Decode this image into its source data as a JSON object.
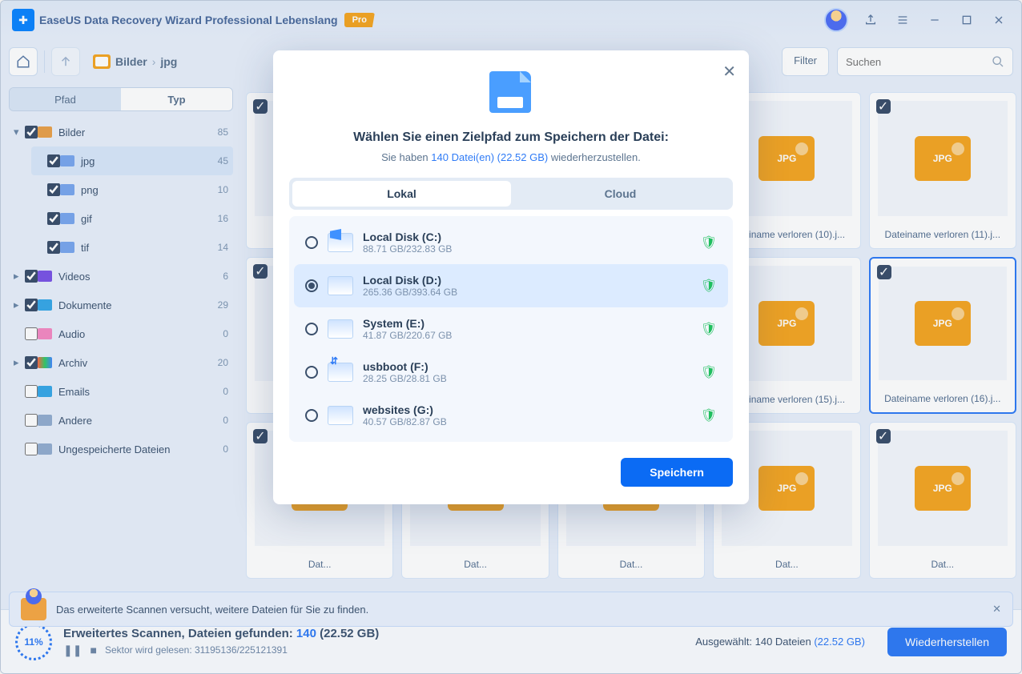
{
  "app": {
    "title": "EaseUS Data Recovery Wizard Professional Lebenslang",
    "pro_badge": "Pro"
  },
  "breadcrumbs": {
    "item1": "Bilder",
    "item2": "jpg"
  },
  "toolbar": {
    "filter": "Filter",
    "search_placeholder": "Suchen"
  },
  "sidebar": {
    "tab_path": "Pfad",
    "tab_type": "Typ",
    "tree": {
      "bilder": {
        "label": "Bilder",
        "count": "85",
        "checked": true,
        "expanded": true,
        "children": {
          "jpg": {
            "label": "jpg",
            "count": "45",
            "checked": true,
            "selected": true
          },
          "png": {
            "label": "png",
            "count": "10",
            "checked": true
          },
          "gif": {
            "label": "gif",
            "count": "16",
            "checked": true
          },
          "tif": {
            "label": "tif",
            "count": "14",
            "checked": true
          }
        }
      },
      "videos": {
        "label": "Videos",
        "count": "6",
        "checked": true
      },
      "dokumente": {
        "label": "Dokumente",
        "count": "29",
        "checked": true
      },
      "audio": {
        "label": "Audio",
        "count": "0",
        "checked": false
      },
      "archiv": {
        "label": "Archiv",
        "count": "20",
        "checked": true
      },
      "emails": {
        "label": "Emails",
        "count": "0",
        "checked": false
      },
      "andere": {
        "label": "Andere",
        "count": "0",
        "checked": false
      },
      "ungespeicherte": {
        "label": "Ungespeicherte Dateien",
        "count": "0",
        "checked": false
      }
    }
  },
  "thumbs": [
    {
      "label": "Dateiname verloren (10).j...",
      "checked": true
    },
    {
      "label": "Dateiname verloren (11).j...",
      "checked": true
    },
    {
      "label": "Dateiname verloren (15).j...",
      "checked": true
    },
    {
      "label": "Dateiname verloren (16).j...",
      "checked": true,
      "selected": true
    }
  ],
  "notice": {
    "text": "Das erweiterte Scannen versucht, weitere Dateien für Sie zu finden."
  },
  "footer": {
    "percent": "11%",
    "title_pre": "Erweitertes Scannen, Dateien gefunden: ",
    "title_count": "140",
    "title_size": " (22.52 GB)",
    "sector": "Sektor wird gelesen: 31195136/225121391",
    "selected_pre": "Ausgewählt: 140 Dateien ",
    "selected_size": "(22.52 GB)",
    "recover": "Wiederherstellen"
  },
  "modal": {
    "title": "Wählen Sie einen Zielpfad zum Speichern der Datei:",
    "sub_pre": "Sie haben ",
    "sub_hl": "140 Datei(en) (22.52 GB) ",
    "sub_post": "wiederherzustellen.",
    "seg_local": "Lokal",
    "seg_cloud": "Cloud",
    "disks": [
      {
        "name": "Local Disk (C:)",
        "size": "88.71 GB/232.83 GB",
        "icon": "win"
      },
      {
        "name": "Local Disk (D:)",
        "size": "265.36 GB/393.64 GB",
        "selected": true
      },
      {
        "name": "System (E:)",
        "size": "41.87 GB/220.67 GB"
      },
      {
        "name": "usbboot (F:)",
        "size": "28.25 GB/28.81 GB",
        "icon": "usb"
      },
      {
        "name": "websites (G:)",
        "size": "40.57 GB/82.87 GB"
      }
    ],
    "save": "Speichern"
  }
}
